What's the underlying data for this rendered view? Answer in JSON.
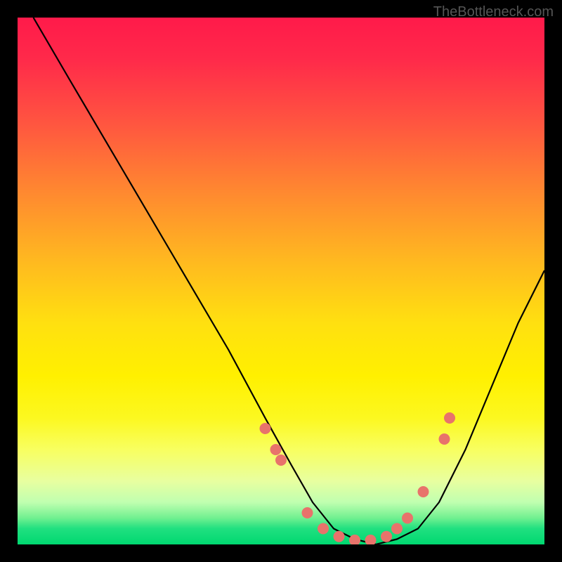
{
  "watermark": "TheBottleneck.com",
  "chart_data": {
    "type": "line",
    "title": "",
    "xlabel": "",
    "ylabel": "",
    "xlim": [
      0,
      100
    ],
    "ylim": [
      0,
      100
    ],
    "curve": {
      "name": "bottleneck-curve",
      "x": [
        3,
        10,
        20,
        30,
        40,
        47,
        52,
        56,
        60,
        64,
        68,
        72,
        76,
        80,
        85,
        90,
        95,
        100
      ],
      "y": [
        100,
        88,
        71,
        54,
        37,
        24,
        15,
        8,
        3,
        1,
        0,
        1,
        3,
        8,
        18,
        30,
        42,
        52
      ]
    },
    "markers": {
      "name": "curve-dots",
      "color": "#e8736b",
      "x": [
        47,
        49,
        50,
        55,
        58,
        61,
        64,
        67,
        70,
        72,
        74,
        77,
        81,
        82
      ],
      "y": [
        22,
        18,
        16,
        6,
        3,
        1.5,
        0.8,
        0.8,
        1.5,
        3,
        5,
        10,
        20,
        24
      ]
    },
    "gradient_stops": [
      {
        "pos": 0,
        "color": "#ff1a4a"
      },
      {
        "pos": 50,
        "color": "#ffd000"
      },
      {
        "pos": 100,
        "color": "#00d870"
      }
    ]
  }
}
